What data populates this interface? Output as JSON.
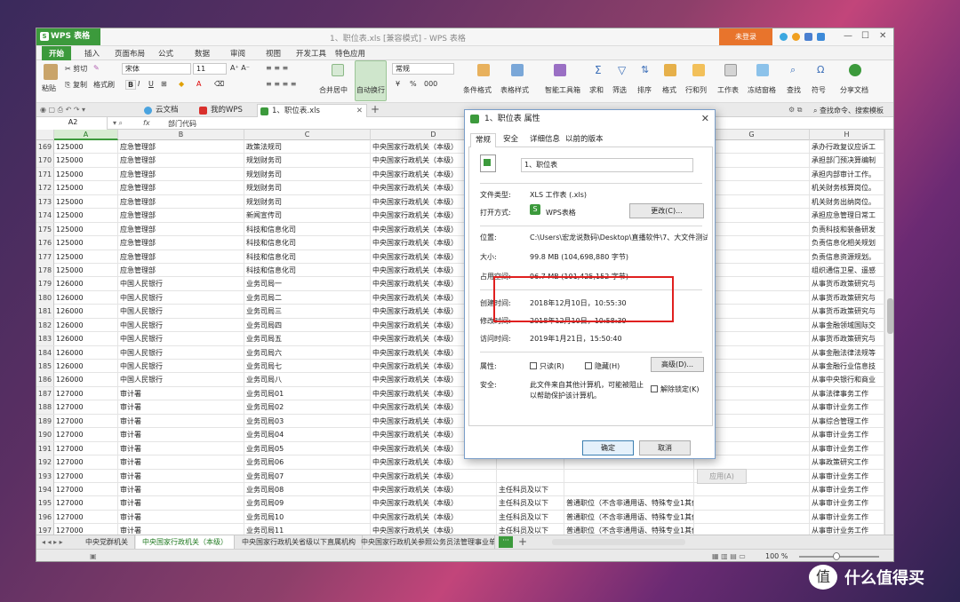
{
  "app": {
    "name": "WPS 表格",
    "doc_title": "1、职位表.xls [兼容模式] - WPS 表格",
    "login_label": "未登录"
  },
  "menu": {
    "items": [
      "开始",
      "插入",
      "页面布局",
      "公式",
      "数据",
      "审阅",
      "视图",
      "开发工具",
      "特色应用"
    ]
  },
  "ribbon": {
    "paste": "粘贴",
    "cut": "剪切",
    "copy": "复制",
    "format_painter": "格式刷",
    "font_name": "宋体",
    "font_size": "11",
    "bold": "B",
    "italic": "I",
    "underline": "U",
    "merge_center": "合并居中",
    "wrap_text": "自动换行",
    "number_format": "常规",
    "currency": "¥",
    "percent": "%",
    "thousands": "000",
    "conditional_format": "条件格式",
    "table_style": "表格样式",
    "smart_toolbox": "智能工具箱",
    "sum": "求和",
    "filter": "筛选",
    "sort": "排序",
    "format": "格式",
    "rows_cols": "行和列",
    "worksheet": "工作表",
    "freeze": "冻结窗格",
    "find": "查找",
    "symbol": "符号",
    "share": "分享文档"
  },
  "doc_tabs": {
    "cloud": "云文档",
    "mywps": "我的WPS",
    "file": "1、职位表.xls",
    "search": "查找命令、搜索模板"
  },
  "formula_bar": {
    "cell_ref": "A2",
    "fx": "fx",
    "content": "部门代码"
  },
  "columns": [
    "A",
    "B",
    "C",
    "D",
    "E",
    "F",
    "G",
    "H"
  ],
  "rows": [
    {
      "n": "169",
      "a": "125000",
      "b": "应急管理部",
      "c": "政策法规司",
      "d": "中央国家行政机关（本级）",
      "e": "",
      "f": "",
      "g": "",
      "h": "承办行政复议应诉工"
    },
    {
      "n": "170",
      "a": "125000",
      "b": "应急管理部",
      "c": "规划财务司",
      "d": "中央国家行政机关（本级）",
      "e": "",
      "f": "",
      "g": "",
      "h": "承担部门预决算编制"
    },
    {
      "n": "171",
      "a": "125000",
      "b": "应急管理部",
      "c": "规划财务司",
      "d": "中央国家行政机关（本级）",
      "e": "",
      "f": "",
      "g": "",
      "h": "承担内部审计工作。"
    },
    {
      "n": "172",
      "a": "125000",
      "b": "应急管理部",
      "c": "规划财务司",
      "d": "中央国家行政机关（本级）",
      "e": "",
      "f": "",
      "g": "",
      "h": "机关财务核算岗位。"
    },
    {
      "n": "173",
      "a": "125000",
      "b": "应急管理部",
      "c": "规划财务司",
      "d": "中央国家行政机关（本级）",
      "e": "",
      "f": "",
      "g": "",
      "h": "机关财务出纳岗位。"
    },
    {
      "n": "174",
      "a": "125000",
      "b": "应急管理部",
      "c": "新闻宣传司",
      "d": "中央国家行政机关（本级）",
      "e": "",
      "f": "",
      "g": "",
      "h": "承担应急管理日常工"
    },
    {
      "n": "175",
      "a": "125000",
      "b": "应急管理部",
      "c": "科技和信息化司",
      "d": "中央国家行政机关（本级）",
      "e": "",
      "f": "",
      "g": "",
      "h": "负责科技和装备研发"
    },
    {
      "n": "176",
      "a": "125000",
      "b": "应急管理部",
      "c": "科技和信息化司",
      "d": "中央国家行政机关（本级）",
      "e": "",
      "f": "",
      "g": "",
      "h": "负责信息化相关规划"
    },
    {
      "n": "177",
      "a": "125000",
      "b": "应急管理部",
      "c": "科技和信息化司",
      "d": "中央国家行政机关（本级）",
      "e": "",
      "f": "",
      "g": "",
      "h": "负责信息资源规划。"
    },
    {
      "n": "178",
      "a": "125000",
      "b": "应急管理部",
      "c": "科技和信息化司",
      "d": "中央国家行政机关（本级）",
      "e": "",
      "f": "",
      "g": "",
      "h": "组织通信卫星、遥感"
    },
    {
      "n": "179",
      "a": "126000",
      "b": "中国人民银行",
      "c": "业务司局一",
      "d": "中央国家行政机关（本级）",
      "e": "",
      "f": "",
      "g": "",
      "h": "从事货币政策研究与"
    },
    {
      "n": "180",
      "a": "126000",
      "b": "中国人民银行",
      "c": "业务司局二",
      "d": "中央国家行政机关（本级）",
      "e": "",
      "f": "",
      "g": "",
      "h": "从事货币政策研究与"
    },
    {
      "n": "181",
      "a": "126000",
      "b": "中国人民银行",
      "c": "业务司局三",
      "d": "中央国家行政机关（本级）",
      "e": "",
      "f": "",
      "g": "",
      "h": "从事货币政策研究与"
    },
    {
      "n": "182",
      "a": "126000",
      "b": "中国人民银行",
      "c": "业务司局四",
      "d": "中央国家行政机关（本级）",
      "e": "",
      "f": "",
      "g": "",
      "h": "从事金融领域国际交"
    },
    {
      "n": "183",
      "a": "126000",
      "b": "中国人民银行",
      "c": "业务司局五",
      "d": "中央国家行政机关（本级）",
      "e": "",
      "f": "",
      "g": "",
      "h": "从事货币政策研究与"
    },
    {
      "n": "184",
      "a": "126000",
      "b": "中国人民银行",
      "c": "业务司局六",
      "d": "中央国家行政机关（本级）",
      "e": "",
      "f": "",
      "g": "",
      "h": "从事金融法律法规等"
    },
    {
      "n": "185",
      "a": "126000",
      "b": "中国人民银行",
      "c": "业务司局七",
      "d": "中央国家行政机关（本级）",
      "e": "",
      "f": "",
      "g": "",
      "h": "从事金融行业信息技"
    },
    {
      "n": "186",
      "a": "126000",
      "b": "中国人民银行",
      "c": "业务司局八",
      "d": "中央国家行政机关（本级）",
      "e": "",
      "f": "",
      "g": "",
      "h": "从事中央银行和商业"
    },
    {
      "n": "187",
      "a": "127000",
      "b": "审计署",
      "c": "业务司局01",
      "d": "中央国家行政机关（本级）",
      "e": "",
      "f": "",
      "g": "",
      "h": "从事法律事务工作"
    },
    {
      "n": "188",
      "a": "127000",
      "b": "审计署",
      "c": "业务司局02",
      "d": "中央国家行政机关（本级）",
      "e": "",
      "f": "",
      "g": "",
      "h": "从事审计业务工作"
    },
    {
      "n": "189",
      "a": "127000",
      "b": "审计署",
      "c": "业务司局03",
      "d": "中央国家行政机关（本级）",
      "e": "",
      "f": "",
      "g": "",
      "h": "从事综合管理工作"
    },
    {
      "n": "190",
      "a": "127000",
      "b": "审计署",
      "c": "业务司局04",
      "d": "中央国家行政机关（本级）",
      "e": "",
      "f": "",
      "g": "",
      "h": "从事审计业务工作"
    },
    {
      "n": "191",
      "a": "127000",
      "b": "审计署",
      "c": "业务司局05",
      "d": "中央国家行政机关（本级）",
      "e": "",
      "f": "",
      "g": "",
      "h": "从事审计业务工作"
    },
    {
      "n": "192",
      "a": "127000",
      "b": "审计署",
      "c": "业务司局06",
      "d": "中央国家行政机关（本级）",
      "e": "",
      "f": "",
      "g": "",
      "h": "从事政策研究工作"
    },
    {
      "n": "193",
      "a": "127000",
      "b": "审计署",
      "c": "业务司局07",
      "d": "中央国家行政机关（本级）",
      "e": "",
      "f": "",
      "g": "",
      "h": "从事审计业务工作"
    },
    {
      "n": "194",
      "a": "127000",
      "b": "审计署",
      "c": "业务司局08",
      "d": "中央国家行政机关（本级）",
      "e": "主任科员及以下",
      "f": "",
      "g": "",
      "h": "从事审计业务工作"
    },
    {
      "n": "195",
      "a": "127000",
      "b": "审计署",
      "c": "业务司局09",
      "d": "中央国家行政机关（本级）",
      "e": "主任科员及以下",
      "f": "普通职位（不含非通用语、特殊专业1其他职位",
      "g": "",
      "h": "从事审计业务工作"
    },
    {
      "n": "196",
      "a": "127000",
      "b": "审计署",
      "c": "业务司局10",
      "d": "中央国家行政机关（本级）",
      "e": "主任科员及以下",
      "f": "普通职位（不含非通用语、特殊专业1其他职位",
      "g": "",
      "h": "从事审计业务工作"
    },
    {
      "n": "197",
      "a": "127000",
      "b": "审计署",
      "c": "业务司局11",
      "d": "中央国家行政机关（本级）",
      "e": "主任科员及以下",
      "f": "普通职位（不含非通用语、特殊专业1其他职位",
      "g": "",
      "h": "从事审计业务工作"
    }
  ],
  "sheet_tabs": [
    "中央党群机关",
    "中央国家行政机关（本级）",
    "中央国家行政机关省级以下直属机构",
    "中央国家行政机关参照公务员法管理事业单"
  ],
  "status": {
    "zoom": "100 %"
  },
  "dialog": {
    "title": "1、职位表 属性",
    "tabs": [
      "常规",
      "安全",
      "详细信息",
      "以前的版本"
    ],
    "filename": "1、职位表",
    "file_type_label": "文件类型:",
    "file_type_value": "XLS 工作表 (.xls)",
    "open_with_label": "打开方式:",
    "open_with_value": "WPS表格",
    "change_button": "更改(C)...",
    "location_label": "位置:",
    "location_value": "C:\\Users\\宏龙说数码\\Desktop\\直播软件\\7、大文件测试",
    "size_label": "大小:",
    "size_value": "99.8 MB (104,698,880 字节)",
    "disk_size_label": "占用空间:",
    "disk_size_value": "96.7 MB (101,425,152 字节)",
    "created_label": "创建时间:",
    "created_value": "2018年12月10日，10:55:30",
    "modified_label": "修改时间:",
    "modified_value": "2018年12月10日，10:58:39",
    "accessed_label": "访问时间:",
    "accessed_value": "2019年1月21日，15:50:40",
    "attributes_label": "属性:",
    "readonly_label": "只读(R)",
    "hidden_label": "隐藏(H)",
    "advanced_button": "高级(D)...",
    "security_label": "安全:",
    "security_text_1": "此文件来自其他计算机，可能被阻止",
    "security_text_2": "以帮助保护该计算机。",
    "unblock_label": "解除锁定(K)",
    "ok": "确定",
    "cancel": "取消",
    "apply": "应用(A)"
  },
  "watermark": {
    "logo": "值",
    "text": "什么值得买"
  },
  "colors": {
    "brand_green": "#3c9a3c",
    "login_orange": "#e8742c",
    "highlight_red": "#e0201f"
  }
}
